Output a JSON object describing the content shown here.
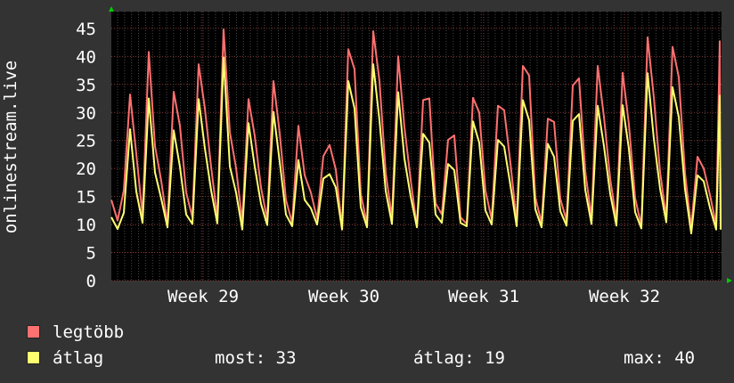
{
  "chart_data": {
    "type": "line",
    "ylabel": "onlinestream.live",
    "ylim": [
      0,
      48
    ],
    "yticks": [
      0,
      5,
      10,
      15,
      20,
      25,
      30,
      35,
      40,
      45
    ],
    "xticks": [
      "Week 29",
      "Week 30",
      "Week 31",
      "Week 32"
    ],
    "grid": true,
    "legend_position": "bottom-left",
    "series": [
      {
        "name": "legtöbb",
        "color": "#ff7070",
        "values": [
          14.4,
          10.7,
          16.1,
          33.2,
          22.6,
          11.6,
          40.8,
          24.0,
          17.8,
          10.0,
          33.7,
          27.6,
          15.7,
          11.3,
          38.6,
          30.7,
          20.3,
          11.2,
          44.8,
          26.5,
          20.1,
          10.5,
          32.4,
          25.8,
          16.6,
          10.9,
          35.6,
          26.3,
          14.4,
          10.3,
          27.6,
          18.8,
          15.7,
          11.0,
          22.2,
          24.2,
          19.8,
          9.4,
          41.3,
          37.7,
          15.5,
          10.1,
          44.5,
          35.6,
          19.3,
          11.2,
          40.0,
          27.4,
          18.0,
          9.6,
          32.2,
          32.5,
          13.8,
          11.8,
          25.1,
          25.9,
          11.3,
          10.1,
          32.6,
          30.0,
          16.0,
          10.9,
          31.2,
          30.4,
          21.0,
          10.5,
          38.3,
          36.6,
          14.8,
          10.3,
          28.9,
          28.3,
          14.6,
          10.7,
          34.8,
          36.1,
          19.5,
          11.2,
          38.3,
          29.2,
          18.2,
          10.7,
          37.1,
          27.9,
          14.7,
          9.8,
          43.4,
          32.7,
          19.4,
          11.2,
          41.7,
          36.3,
          19.2,
          9.4,
          22.1,
          20.0,
          15.3,
          9.9
        ]
      },
      {
        "name": "átlag",
        "color": "#ffff70",
        "values": [
          11.3,
          9.2,
          12.1,
          27.0,
          15.9,
          10.3,
          32.5,
          19.3,
          14.6,
          9.5,
          26.8,
          20.3,
          11.8,
          10.1,
          32.4,
          23.6,
          16.1,
          10.2,
          39.8,
          20.4,
          15.7,
          9.1,
          28.1,
          20.3,
          13.7,
          9.9,
          30.1,
          21.2,
          11.8,
          9.7,
          21.5,
          14.4,
          12.9,
          10.0,
          18.2,
          19.0,
          16.6,
          9.1,
          35.6,
          30.7,
          13.1,
          9.5,
          38.6,
          28.6,
          16.0,
          10.1,
          33.6,
          21.8,
          15.0,
          9.5,
          26.2,
          24.6,
          11.8,
          10.3,
          20.8,
          19.7,
          10.3,
          9.7,
          28.4,
          24.6,
          12.5,
          10.0,
          25.1,
          23.9,
          17.0,
          9.7,
          32.2,
          28.6,
          12.7,
          9.5,
          24.4,
          22.1,
          12.4,
          9.8,
          28.5,
          29.7,
          16.2,
          10.1,
          31.2,
          24.0,
          15.5,
          9.8,
          31.3,
          23.5,
          12.2,
          9.3,
          37.0,
          25.3,
          16.4,
          10.4,
          34.5,
          29.2,
          16.3,
          8.4,
          18.8,
          17.7,
          13.0,
          9.1
        ]
      }
    ],
    "x_spikes": [
      {
        "series": "legtöbb",
        "values": [
          42.7
        ]
      },
      {
        "series": "átlag",
        "values": [
          33.0
        ]
      }
    ]
  },
  "legend": {
    "max_label": "legtöbb",
    "avg_label": "átlag",
    "now_label": "most:",
    "now_value": "33",
    "avg_stat_label": "átlag:",
    "avg_value": "19",
    "max_stat_label": "max:",
    "max_value": "40"
  },
  "colors": {
    "background": "#333333",
    "plot_background": "#000000",
    "grid_major": "#8c3a3a",
    "grid_minor": "#4a4a4a",
    "arrow": "#00cc00",
    "text": "#ffffff"
  }
}
